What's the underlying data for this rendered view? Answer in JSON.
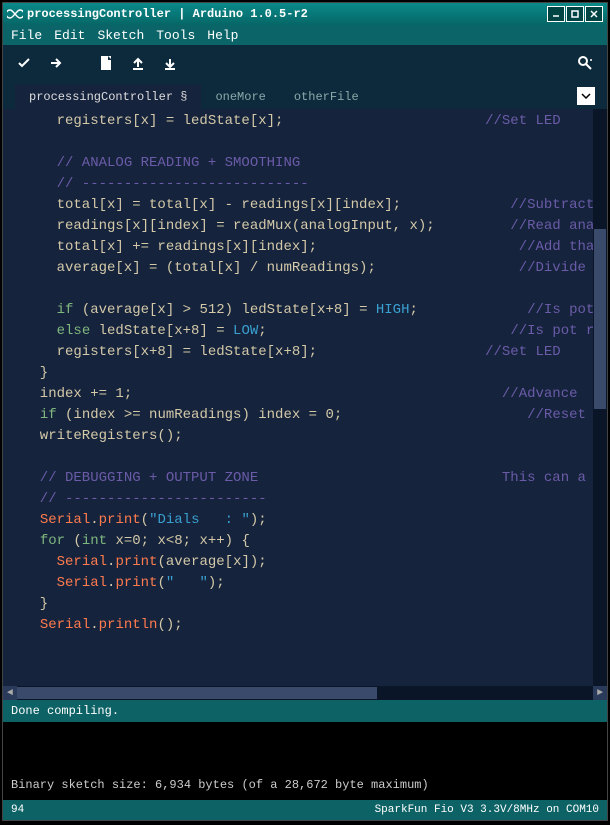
{
  "window": {
    "title": "processingController | Arduino 1.0.5-r2"
  },
  "menu": {
    "file": "File",
    "edit": "Edit",
    "sketch": "Sketch",
    "tools": "Tools",
    "help": "Help"
  },
  "tabs": {
    "t0": "processingController §",
    "t1": "oneMore",
    "t2": "otherFile"
  },
  "code": {
    "l01a": "    registers[x] = ledState[x];",
    "l01c": "//Set LED ",
    "l02": "",
    "l03": "    // ANALOG READING + SMOOTHING",
    "l04": "    // ---------------------------",
    "l05a": "    total[x] = total[x] - readings[x][index];",
    "l05c": "//Subtract",
    "l06a": "    readings[x][index] = readMux(analogInput, x);",
    "l06c": "//Read ana",
    "l07a": "    total[x] += readings[x][index];",
    "l07c": "//Add that",
    "l08a": "    average[x] = (total[x] / numReadings);",
    "l08c": "//Divide t",
    "l09": "",
    "l10_if": "if",
    "l10a": " (average[x] > 512) ledState[x+8] = ",
    "l10h": "HIGH",
    "l10s": ";",
    "l10c": "//Is pot r",
    "l11_else": "else",
    "l11a": " ledState[x+8] = ",
    "l11l": "LOW",
    "l11s": ";",
    "l11c": "//Is pot r",
    "l12a": "    registers[x+8] = ledState[x+8];",
    "l12c": "//Set LED ",
    "l13": "  }",
    "l14a": "  index += 1;",
    "l14c": "//Advance ",
    "l15_if": "if",
    "l15a": " (index >= numReadings) index = 0;",
    "l15c": "//Reset in",
    "l16": "  writeRegisters();",
    "l17": "",
    "l18": "  // DEBUGGING + OUTPUT ZONE",
    "l18c": "This can a",
    "l19": "  // ------------------------",
    "l20_s": "Serial",
    "l20_p": "print",
    "l20_str": "\"Dials   : \"",
    "l21_for": "for",
    "l21_int": "int",
    "l21a": " x=0; x<8; x++) {",
    "l22_s": "Serial",
    "l22_p": "print",
    "l22a": "(average[x]);",
    "l23_s": "Serial",
    "l23_p": "print",
    "l23_str": "\"   \"",
    "l24": "  }",
    "l25_s": "Serial",
    "l25_p": "println",
    "l25a": "();"
  },
  "console": {
    "header": "Done compiling.",
    "body": "Binary sketch size: 6,934 bytes (of a 28,672 byte maximum)"
  },
  "status": {
    "line": "94",
    "board": "SparkFun Fio V3 3.3V/8MHz on COM10"
  }
}
